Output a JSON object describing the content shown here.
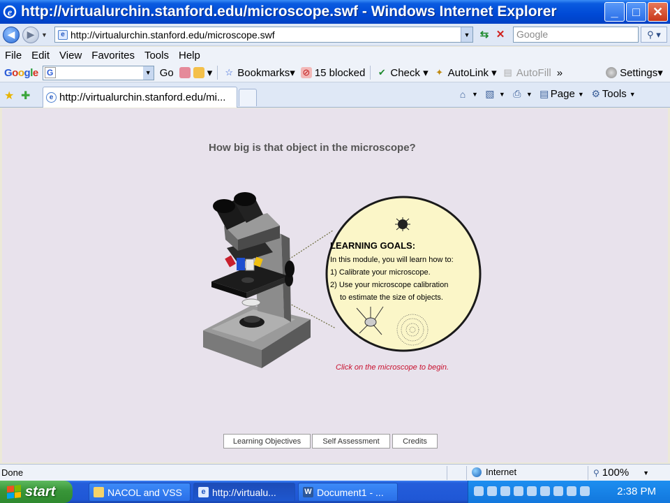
{
  "window": {
    "title": "http://virtualurchin.stanford.edu/microscope.swf - Windows Internet Explorer",
    "minimize": "_",
    "maximize": "□",
    "close": "✕"
  },
  "address_bar": {
    "url": "http://virtualurchin.stanford.edu/microscope.swf",
    "search_placeholder": "Google"
  },
  "menu": [
    "File",
    "Edit",
    "View",
    "Favorites",
    "Tools",
    "Help"
  ],
  "google_toolbar": {
    "logo": "Google",
    "go_label": "Go",
    "bookmarks_label": "Bookmarks",
    "blocked_label": "15 blocked",
    "check_label": "Check",
    "autolink_label": "AutoLink",
    "autofill_label": "AutoFill",
    "more_label": "»",
    "settings_label": "Settings"
  },
  "tabs": [
    {
      "label": "http://virtualurchin.stanford.edu/mi..."
    }
  ],
  "command_bar": {
    "page_label": "Page",
    "tools_label": "Tools"
  },
  "content": {
    "heading": "How big is that object in the microscope?",
    "goals_title": "LEARNING GOALS:",
    "goals_intro": "In this module, you will learn how to:",
    "goal_1": "1) Calibrate your microscope.",
    "goal_2_line1": "2) Use your microscope calibration",
    "goal_2_line2": "to estimate the size of objects.",
    "cta": "Click on the microscope to begin.",
    "buttons": {
      "objectives": "Learning Objectives",
      "assessment": "Self Assessment",
      "credits": "Credits"
    }
  },
  "status_bar": {
    "status": "Done",
    "zone": "Internet",
    "zoom": "100%"
  },
  "taskbar": {
    "start": "start",
    "tasks": [
      {
        "label": "NACOL and VSS"
      },
      {
        "label": "http://virtualu..."
      },
      {
        "label": "Document1 - ..."
      }
    ],
    "clock": "2:38 PM"
  },
  "icons": {
    "back": "back-arrow-icon",
    "forward": "forward-arrow-icon",
    "refresh": "refresh-icon",
    "stop": "stop-icon",
    "search": "search-icon",
    "favorites": "star-icon",
    "add_favorite": "add-favorite-icon",
    "home": "home-icon",
    "feeds": "feeds-icon",
    "print": "print-icon",
    "globe": "globe-icon"
  },
  "colors": {
    "titlebar": "#0049d6",
    "content_bg": "#e8e2ec",
    "lens_fill": "#fbf6c8",
    "cta": "#c8102e",
    "start_green": "#389538"
  }
}
